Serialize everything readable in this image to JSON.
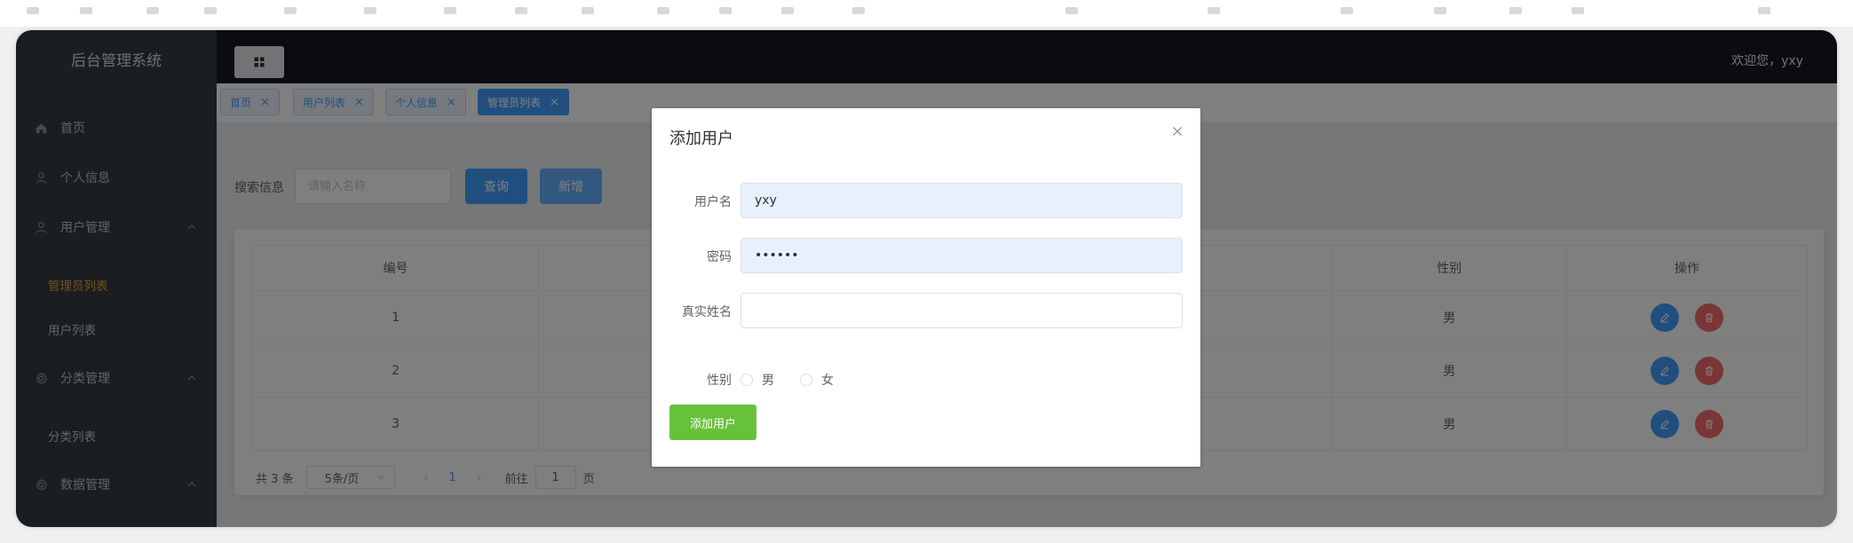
{
  "sidebar": {
    "title": "后台管理系统",
    "menu": {
      "home": "首页",
      "profile": "个人信息",
      "user_mgmt": "用户管理",
      "admin_list": "管理员列表",
      "user_list": "用户列表",
      "category_mgmt": "分类管理",
      "category_list": "分类列表",
      "data_mgmt": "数据管理"
    }
  },
  "header": {
    "welcome": "欢迎您，yxy"
  },
  "tabs": [
    {
      "label": "首页",
      "close": "×"
    },
    {
      "label": "用户列表",
      "close": "×"
    },
    {
      "label": "个人信息",
      "close": "×"
    },
    {
      "label": "管理员列表",
      "close": "×"
    }
  ],
  "search": {
    "label": "搜索信息",
    "placeholder": "请输入名称",
    "query_label": "查询",
    "add_label": "新增"
  },
  "table": {
    "headers": {
      "id": "编号",
      "gender": "性别",
      "actions": "操作"
    },
    "rows": [
      {
        "id": "1",
        "gender": "男"
      },
      {
        "id": "2",
        "gender": "男"
      },
      {
        "id": "3",
        "gender": "男"
      }
    ]
  },
  "pagination": {
    "total": "共 3 条",
    "page_size": "5条/页",
    "prev": "‹",
    "current": "1",
    "next": "›",
    "goto": "前往",
    "goto_value": "1",
    "page_suffix": "页"
  },
  "dialog": {
    "title": "添加用户",
    "username_label": "用户名",
    "username_value": "yxy",
    "password_label": "密码",
    "password_value": "••••••",
    "realname_label": "真实姓名",
    "realname_value": "",
    "gender_label": "性别",
    "gender_male": "男",
    "gender_female": "女",
    "submit_label": "添加用户"
  },
  "colors": {
    "sidebar_bg": "#373d41",
    "header_bg": "#141822",
    "primary": "#409eff",
    "active_menu": "#e6a23c",
    "success": "#67c23a",
    "danger": "#f56c6c"
  }
}
